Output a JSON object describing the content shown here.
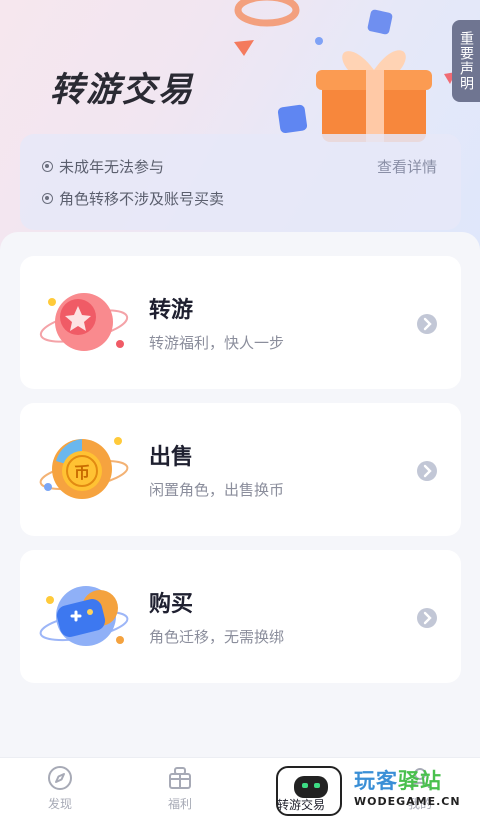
{
  "header": {
    "title": "转游交易",
    "notice_tab": "重要声明"
  },
  "rules": {
    "items": [
      "未成年无法参与",
      "角色转移不涉及账号买卖"
    ],
    "details_link": "查看详情"
  },
  "cards": [
    {
      "title": "转游",
      "subtitle": "转游福利，快人一步",
      "icon": "star-planet-icon"
    },
    {
      "title": "出售",
      "subtitle": "闲置角色，出售换币",
      "icon": "coin-planet-icon"
    },
    {
      "title": "购买",
      "subtitle": "角色迁移，无需换绑",
      "icon": "gamepad-planet-icon"
    }
  ],
  "tabbar": {
    "items": [
      {
        "label": "发现",
        "icon": "compass-icon"
      },
      {
        "label": "福利",
        "icon": "gift-box-icon"
      },
      {
        "label": "转游交易",
        "icon": "robot-icon",
        "active": true
      },
      {
        "label": "我的",
        "icon": "user-icon"
      }
    ]
  },
  "watermark": {
    "cn_part1": "玩客",
    "cn_part2": "驿站",
    "en": "WODEGAME.CN"
  },
  "colors": {
    "accent_blue": "#3a8fd6",
    "accent_green": "#49c04d",
    "arrow_gray": "#c2c7d6"
  }
}
